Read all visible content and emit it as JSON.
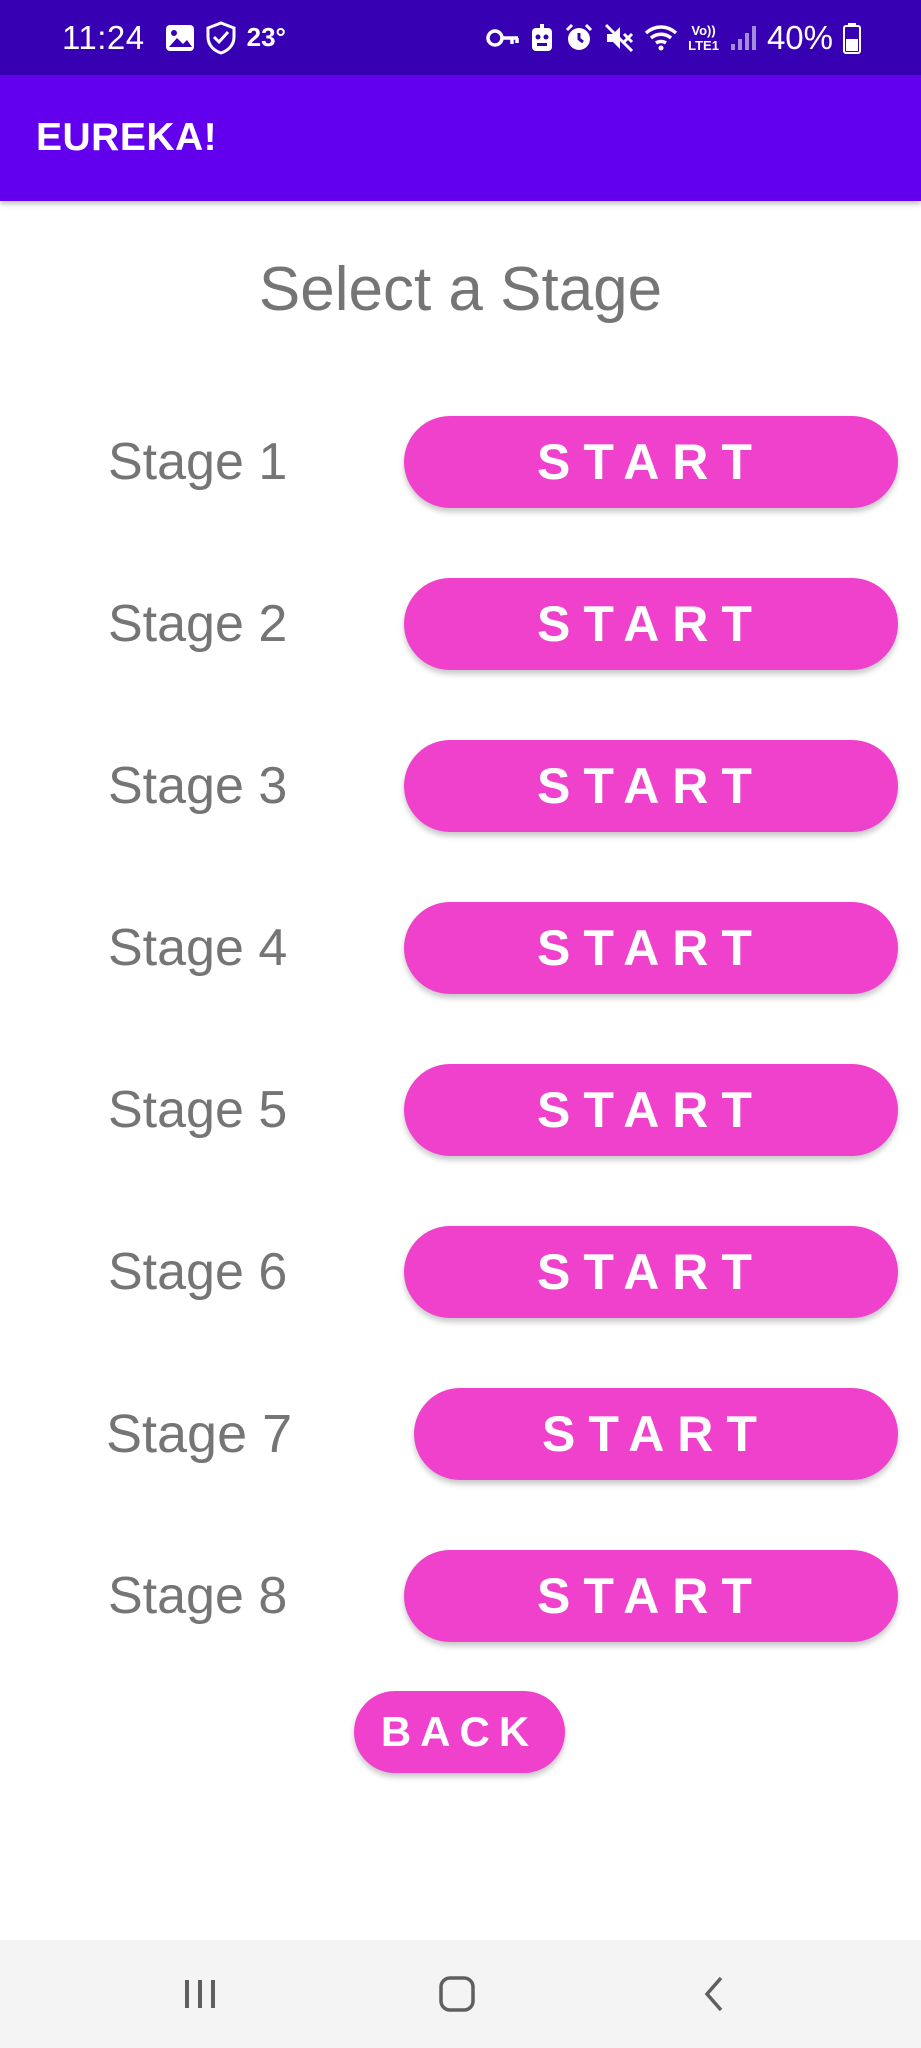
{
  "status_bar": {
    "time": "11:24",
    "temperature": "23°",
    "battery_text": "40%",
    "left_icons": [
      "image-icon",
      "shield-check-icon"
    ],
    "right_icons": [
      "key-icon",
      "robot-icon",
      "alarm-icon",
      "mute-icon",
      "wifi-icon",
      "volte-lte-icon",
      "signal-icon",
      "battery-icon"
    ],
    "volte_label": "Vo))",
    "lte_label": "LTE1"
  },
  "app_bar": {
    "title": "EUREKA!"
  },
  "page": {
    "heading": "Select a Stage",
    "stages": [
      {
        "label": "Stage 1",
        "button": "START"
      },
      {
        "label": "Stage 2",
        "button": "START"
      },
      {
        "label": "Stage 3",
        "button": "START"
      },
      {
        "label": "Stage 4",
        "button": "START"
      },
      {
        "label": "Stage 5",
        "button": "START"
      },
      {
        "label": "Stage 6",
        "button": "START"
      },
      {
        "label": "Stage 7",
        "button": "START"
      },
      {
        "label": "Stage 8",
        "button": "START"
      }
    ],
    "back_button": "BACK"
  },
  "nav_bar": {
    "items": [
      "recent-apps-icon",
      "home-icon",
      "back-icon"
    ]
  },
  "colors": {
    "status_bar": "#3700B3",
    "app_bar": "#6200EE",
    "button": "#EF41CB",
    "text_gray": "#757575"
  }
}
